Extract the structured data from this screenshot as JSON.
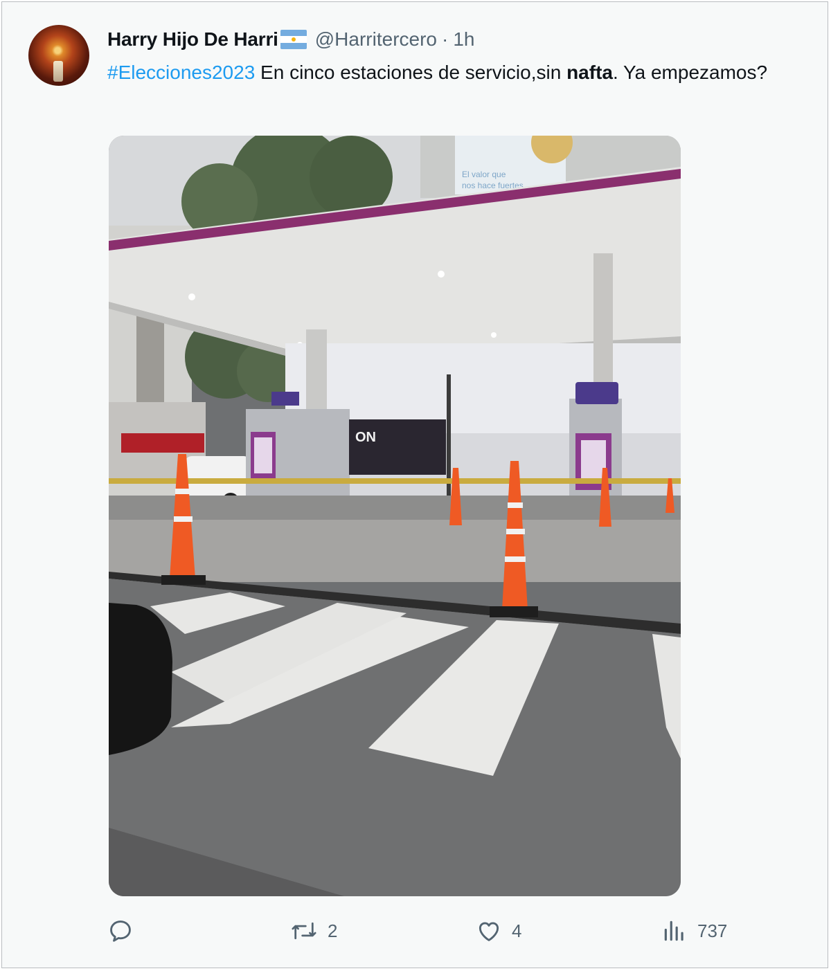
{
  "tweet": {
    "author_name": "Harry Hijo De Harri",
    "author_flag": "argentina-flag-icon",
    "handle": "@Harritercero",
    "separator": "·",
    "time": "1h",
    "hashtag": "#Elecciones2023",
    "text_before_bold": " En cinco estaciones de servicio,sin ",
    "bold_word": "nafta",
    "text_after_bold": ". Ya empezamos?",
    "colors": {
      "hashtag": "#1d9bf0",
      "muted": "#536471",
      "text": "#0f1419"
    }
  },
  "media": {
    "icon": "photo-gas-station-with-traffic-cones",
    "ad_text": "ON",
    "billboard_line1": "El valor que",
    "billboard_line2": "nos hace fuertes"
  },
  "actions": {
    "reply": {
      "icon": "reply-icon",
      "count": ""
    },
    "retweet": {
      "icon": "retweet-icon",
      "count": "2"
    },
    "like": {
      "icon": "heart-icon",
      "count": "4"
    },
    "views": {
      "icon": "views-bar-chart-icon",
      "count": "737"
    }
  }
}
